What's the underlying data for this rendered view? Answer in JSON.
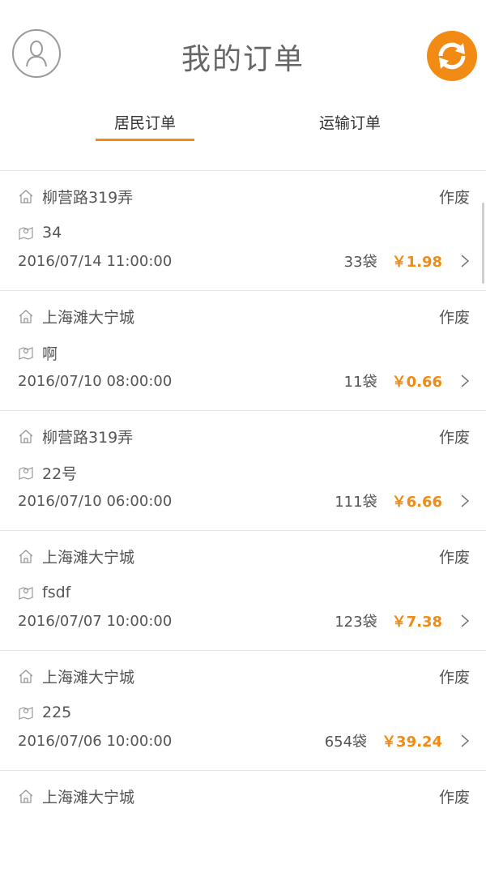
{
  "header": {
    "title": "我的订单"
  },
  "tabs": [
    {
      "label": "居民订单",
      "active": true
    },
    {
      "label": "运输订单",
      "active": false
    }
  ],
  "colors": {
    "accent": "#f28b13",
    "text": "#555555",
    "divider": "#e3e3e3"
  },
  "orders": [
    {
      "address": "柳营路319弄",
      "room": "34",
      "status": "作废",
      "datetime": "2016/07/14 11:00:00",
      "bags": "33袋",
      "price": "￥1.98"
    },
    {
      "address": "上海滩大宁城",
      "room": "啊",
      "status": "作废",
      "datetime": "2016/07/10 08:00:00",
      "bags": "11袋",
      "price": "￥0.66"
    },
    {
      "address": "柳营路319弄",
      "room": "22号",
      "status": "作废",
      "datetime": "2016/07/10 06:00:00",
      "bags": "111袋",
      "price": "￥6.66"
    },
    {
      "address": "上海滩大宁城",
      "room": "fsdf",
      "status": "作废",
      "datetime": "2016/07/07 10:00:00",
      "bags": "123袋",
      "price": "￥7.38"
    },
    {
      "address": "上海滩大宁城",
      "room": "225",
      "status": "作废",
      "datetime": "2016/07/06 10:00:00",
      "bags": "654袋",
      "price": "￥39.24"
    },
    {
      "address": "上海滩大宁城",
      "room": "",
      "status": "作废",
      "datetime": "",
      "bags": "",
      "price": ""
    }
  ]
}
